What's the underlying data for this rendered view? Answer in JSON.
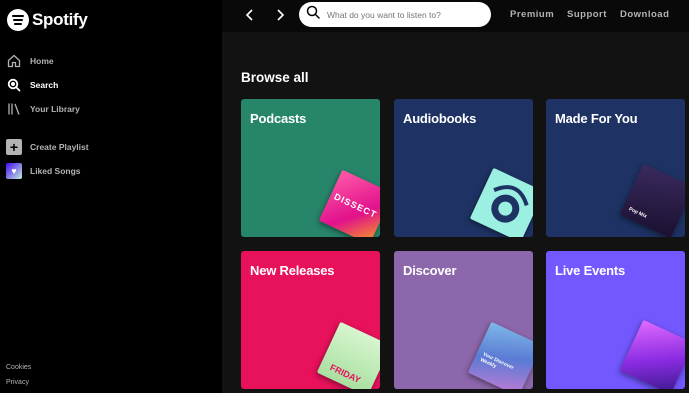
{
  "brand": {
    "name": "Spotify"
  },
  "sidebar": {
    "nav": [
      {
        "label": "Home",
        "icon": "home-icon"
      },
      {
        "label": "Search",
        "icon": "search-icon",
        "active": true
      },
      {
        "label": "Your Library",
        "icon": "library-icon"
      }
    ],
    "actions": [
      {
        "label": "Create Playlist",
        "icon": "plus-icon"
      },
      {
        "label": "Liked Songs",
        "icon": "heart-icon"
      }
    ],
    "legal": [
      "Cookies",
      "Privacy"
    ]
  },
  "topbar": {
    "search_placeholder": "What do you want to listen to?",
    "links": [
      "Premium",
      "Support",
      "Download"
    ]
  },
  "main": {
    "section_title": "Browse all",
    "cards": [
      {
        "title": "Podcasts",
        "color": "#27856a",
        "art_text": "DISSECT",
        "art_color": "#e1118c"
      },
      {
        "title": "Audiobooks",
        "color": "#1e3264",
        "art_text": "",
        "art_color": "#9cf0e1"
      },
      {
        "title": "Made For You",
        "color": "#1e3264",
        "art_text": "Pop Mix",
        "art_color": "#2d1b4e"
      },
      {
        "title": "New Releases",
        "color": "#e8115b",
        "art_text": "FRIDAY",
        "art_color": "#c8f0c8"
      },
      {
        "title": "Discover",
        "color": "#8d67ab",
        "art_text": "Your Discover Weekly",
        "art_color": "#5a9bd4"
      },
      {
        "title": "Live Events",
        "color": "#7358ff",
        "art_text": "",
        "art_color": "#d24dff"
      }
    ]
  }
}
